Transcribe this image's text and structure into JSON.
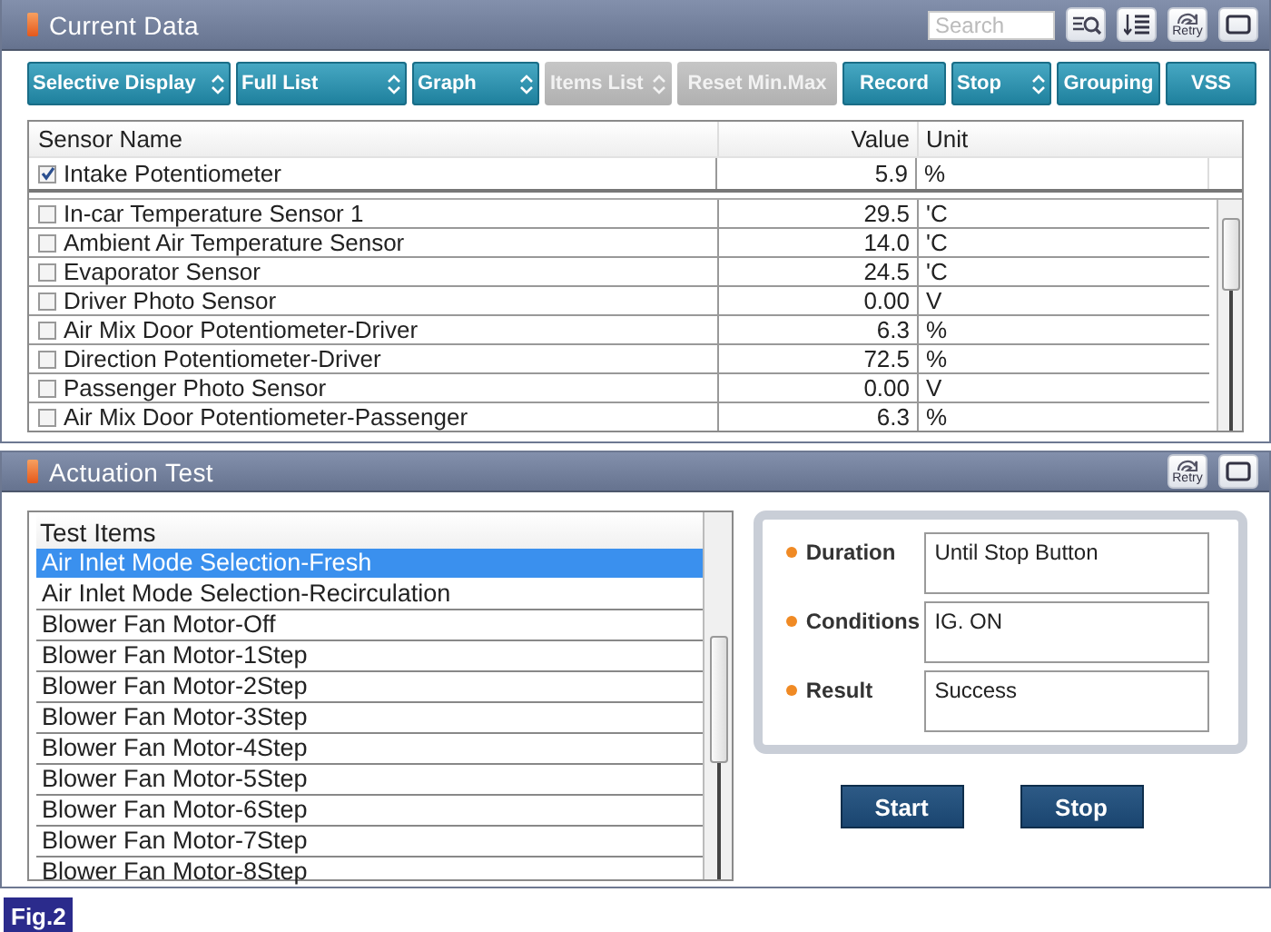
{
  "current_data": {
    "title": "Current Data",
    "search": {
      "placeholder": "Search"
    },
    "retry_label": "Retry"
  },
  "toolbar": [
    {
      "label": "Selective Display",
      "kind": "dropdown",
      "disabled": false
    },
    {
      "label": "Full List",
      "kind": "dropdown",
      "disabled": false
    },
    {
      "label": "Graph",
      "kind": "dropdown",
      "disabled": false
    },
    {
      "label": "Items List",
      "kind": "dropdown",
      "disabled": true
    },
    {
      "label": "Reset Min.Max",
      "kind": "plain",
      "disabled": true
    },
    {
      "label": "Record",
      "kind": "plain",
      "disabled": false
    },
    {
      "label": "Stop",
      "kind": "dropdown",
      "disabled": false
    },
    {
      "label": "Grouping",
      "kind": "plain",
      "disabled": false
    },
    {
      "label": "VSS",
      "kind": "plain",
      "disabled": false
    }
  ],
  "sensor_table": {
    "columns": [
      "Sensor Name",
      "Value",
      "Unit"
    ],
    "pinned": [
      {
        "name": "Intake Potentiometer",
        "value": "5.9",
        "unit": "%",
        "checked": true
      }
    ],
    "rows": [
      {
        "name": "In-car Temperature Sensor 1",
        "value": "29.5",
        "unit": "'C",
        "checked": false
      },
      {
        "name": "Ambient Air Temperature Sensor",
        "value": "14.0",
        "unit": "'C",
        "checked": false
      },
      {
        "name": "Evaporator Sensor",
        "value": "24.5",
        "unit": "'C",
        "checked": false
      },
      {
        "name": "Driver Photo Sensor",
        "value": "0.00",
        "unit": "V",
        "checked": false
      },
      {
        "name": "Air Mix Door Potentiometer-Driver",
        "value": "6.3",
        "unit": "%",
        "checked": false
      },
      {
        "name": "Direction Potentiometer-Driver",
        "value": "72.5",
        "unit": "%",
        "checked": false
      },
      {
        "name": "Passenger Photo Sensor",
        "value": "0.00",
        "unit": "V",
        "checked": false
      },
      {
        "name": "Air Mix Door Potentiometer-Passenger",
        "value": "6.3",
        "unit": "%",
        "checked": false
      }
    ]
  },
  "actuation_test": {
    "title": "Actuation Test",
    "retry_label": "Retry",
    "list_header": "Test Items",
    "items": [
      {
        "label": "Air Inlet Mode Selection-Fresh",
        "selected": true
      },
      {
        "label": "Air Inlet Mode Selection-Recirculation",
        "selected": false
      },
      {
        "label": "Blower Fan Motor-Off",
        "selected": false
      },
      {
        "label": "Blower Fan Motor-1Step",
        "selected": false
      },
      {
        "label": "Blower Fan Motor-2Step",
        "selected": false
      },
      {
        "label": "Blower Fan Motor-3Step",
        "selected": false
      },
      {
        "label": "Blower Fan Motor-4Step",
        "selected": false
      },
      {
        "label": "Blower Fan Motor-5Step",
        "selected": false
      },
      {
        "label": "Blower Fan Motor-6Step",
        "selected": false
      },
      {
        "label": "Blower Fan Motor-7Step",
        "selected": false
      },
      {
        "label": "Blower Fan Motor-8Step",
        "selected": false
      }
    ],
    "fields": [
      {
        "label": "Duration",
        "value": "Until Stop Button"
      },
      {
        "label": "Conditions",
        "value": "IG. ON"
      },
      {
        "label": "Result",
        "value": "Success"
      }
    ],
    "buttons": [
      "Start",
      "Stop"
    ]
  },
  "figure_label": "Fig.2"
}
